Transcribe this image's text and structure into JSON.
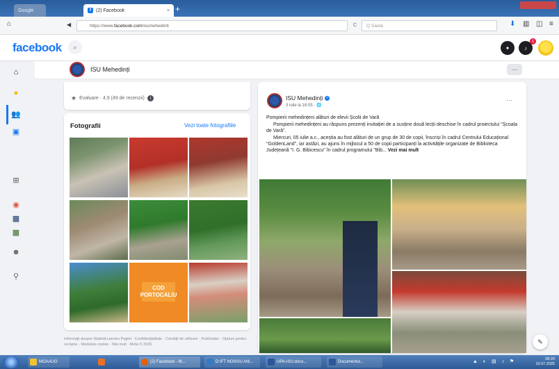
{
  "browser": {
    "tabs": [
      {
        "label": "Google"
      },
      {
        "label": "(2) Facebook",
        "close": "×"
      }
    ],
    "new_tab": "+",
    "back": "◀",
    "url_prefix": "https://www.",
    "url_domain": "facebook.com",
    "url_rest": "/isumehedinti",
    "reload": "C",
    "search_placeholder": "Q Șaută"
  },
  "fb_header": {
    "logo": "facebook",
    "search_icon": "search-icon",
    "messenger_icon": "messenger-icon",
    "notifications_icon": "bell-icon",
    "notifications_count": "1"
  },
  "page": {
    "name": "ISU Mehedinți",
    "more": "···"
  },
  "rating": {
    "text": "Evaluare · 4,9 (49 de recenzii)",
    "info": "i"
  },
  "photos": {
    "title": "Fotografii",
    "see_all": "Vezi toate fotografiile",
    "cod_text_line1": "COD",
    "cod_text_line2": "PORTOCALIU"
  },
  "footer": {
    "text": "Informații despre Statistici pentru Pagini · Confidențialitate · Condiții de utilizare · Publicitate · Opțiuni pentru reclame · Modulele cookie · Mai mult · Meta © 2025"
  },
  "post": {
    "author": "ISU Mehedinți",
    "date": "3 iulie la 18:05 · 🌐",
    "more": "···",
    "line1": "Pompierii mehedințeni alături de elevii Școlii de Vară",
    "para1": "Pompierii mehedințeni au răspuns prezenți invitației de a susține două lecții deschise în cadrul proiectului \"Școala de Vară\".",
    "para2": "Miercuri, 05 iulie a.c., aceștia au fost alături de un grup de 30 de copii, înscriși în cadrul Centrului Educațional \"GoldenLand\", iar astăzi, au ajuns în mijlocul a 50 de copii participanți la activitățile organizate de Biblioteca Județeană \"I. G. Bibicescu\" în cadrul programului \"Bib...",
    "see_more": "Vezi mai mult"
  },
  "taskbar": {
    "items": [
      {
        "label": "MOAAUO"
      },
      {
        "label": ""
      },
      {
        "label": "(2) Facebook - M..."
      },
      {
        "label": "D:\\FT NOI\\ISU Arti..."
      },
      {
        "label": "UPA-ISU.docx..."
      },
      {
        "label": "Documentul..."
      }
    ],
    "time": "08:20",
    "date": "10.07.2025"
  },
  "colors": {
    "fb_blue": "#1877f2",
    "bg": "#f0f2f5",
    "notification_red": "#e41e3f"
  }
}
